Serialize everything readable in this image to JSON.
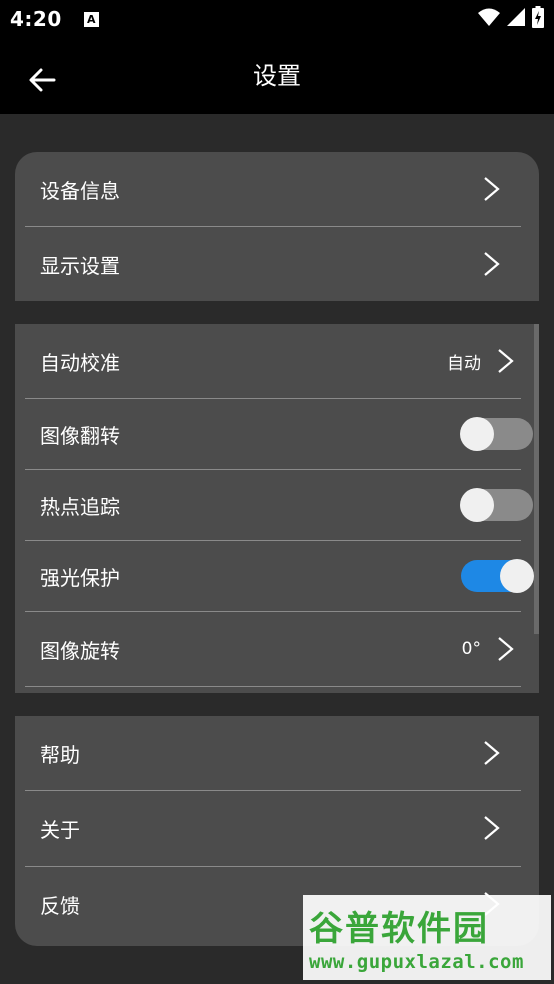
{
  "status_bar": {
    "time": "4:20",
    "notification_icon_letter": "A",
    "icons": [
      "wifi-icon",
      "signal-icon",
      "battery-icon"
    ]
  },
  "app_bar": {
    "title": "设置",
    "back_icon": "arrow-left-icon"
  },
  "sections": {
    "device": {
      "items": [
        {
          "label": "设备信息"
        },
        {
          "label": "显示设置"
        }
      ]
    },
    "image": {
      "auto_calibration": {
        "label": "自动校准",
        "value": "自动"
      },
      "image_flip": {
        "label": "图像翻转",
        "on": false
      },
      "hotspot_tracking": {
        "label": "热点追踪",
        "on": false
      },
      "glare_protection": {
        "label": "强光保护",
        "on": true
      },
      "image_rotation": {
        "label": "图像旋转",
        "value": "0°"
      }
    },
    "other": {
      "items": [
        {
          "label": "帮助"
        },
        {
          "label": "关于"
        },
        {
          "label": "反馈"
        }
      ]
    }
  },
  "watermark": {
    "title": "谷普软件园",
    "url": "www.gupuxlazal.com"
  },
  "colors": {
    "background": "#2a2a2a",
    "card": "#4c4c4c",
    "accent": "#1e88e5",
    "switch_off_track": "#8a8a8a",
    "switch_knob": "#f0f0f0"
  }
}
